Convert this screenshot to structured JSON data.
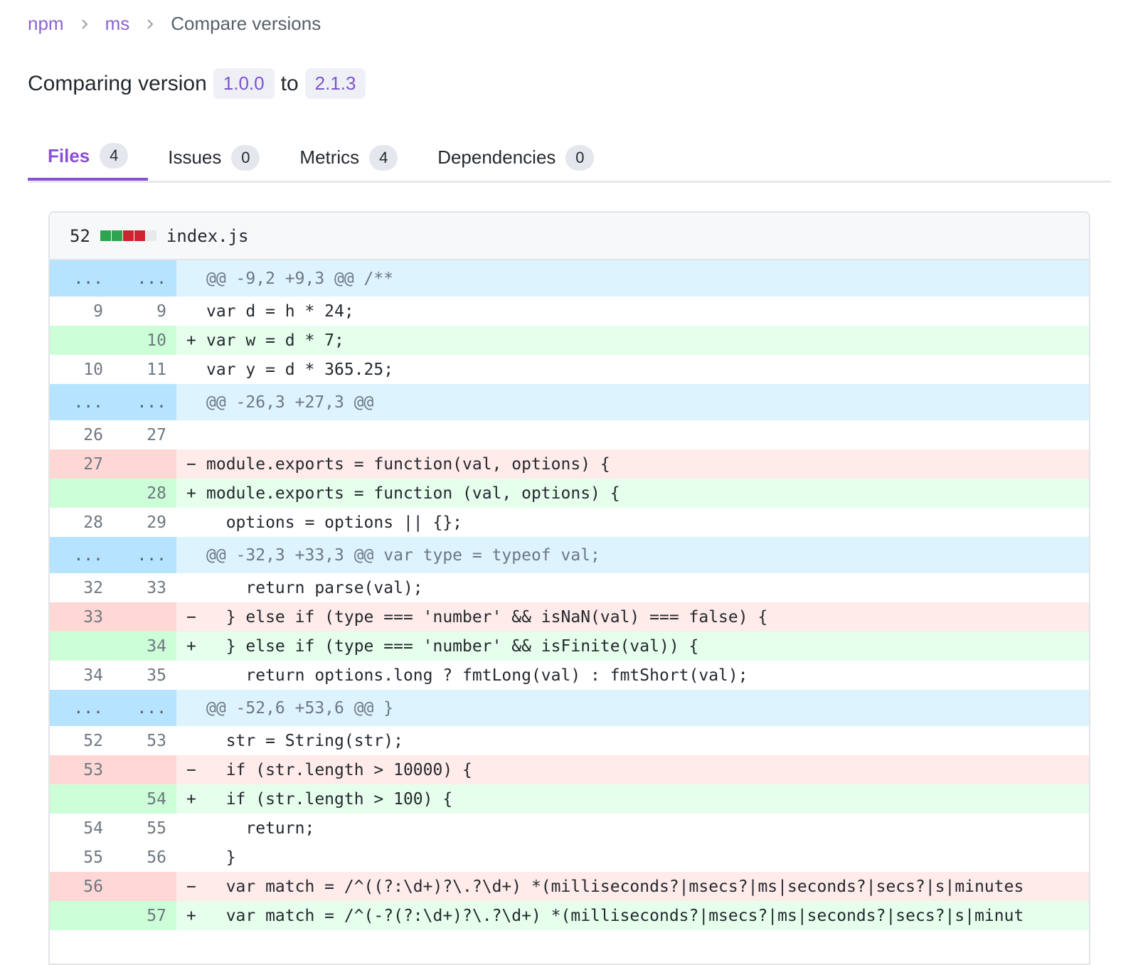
{
  "breadcrumb": {
    "items": [
      "npm",
      "ms"
    ],
    "current": "Compare versions",
    "separator_icon": "chevron-right-icon"
  },
  "compare": {
    "prefix": "Comparing version",
    "from_version": "1.0.0",
    "middle": "to",
    "to_version": "2.1.3"
  },
  "tabs": [
    {
      "label": "Files",
      "count": "4",
      "active": true
    },
    {
      "label": "Issues",
      "count": "0",
      "active": false
    },
    {
      "label": "Metrics",
      "count": "4",
      "active": false
    },
    {
      "label": "Dependencies",
      "count": "0",
      "active": false
    }
  ],
  "colors": {
    "accent": "#8a4fd9",
    "added_bg": "#e6ffec",
    "removed_bg": "#ffebe9",
    "hunk_bg": "#ddf4ff"
  },
  "file": {
    "changes": "52",
    "name": "index.js",
    "stat_blocks": [
      "add",
      "add",
      "del",
      "del",
      "neutral"
    ]
  },
  "diff": [
    {
      "type": "hunk",
      "old": "...",
      "new": "...",
      "text": "@@ -9,2 +9,3 @@ /**"
    },
    {
      "type": "ctx",
      "old": "9",
      "new": "9",
      "text": "var d = h * 24;"
    },
    {
      "type": "add",
      "old": "",
      "new": "10",
      "text": "var w = d * 7;"
    },
    {
      "type": "ctx",
      "old": "10",
      "new": "11",
      "text": "var y = d * 365.25;"
    },
    {
      "type": "hunk",
      "old": "...",
      "new": "...",
      "text": "@@ -26,3 +27,3 @@"
    },
    {
      "type": "ctx",
      "old": "26",
      "new": "27",
      "text": ""
    },
    {
      "type": "del",
      "old": "27",
      "new": "",
      "text": "module.exports = function(val, options) {"
    },
    {
      "type": "add",
      "old": "",
      "new": "28",
      "text": "module.exports = function (val, options) {"
    },
    {
      "type": "ctx",
      "old": "28",
      "new": "29",
      "text": "  options = options || {};"
    },
    {
      "type": "hunk",
      "old": "...",
      "new": "...",
      "text": "@@ -32,3 +33,3 @@ var type = typeof val;"
    },
    {
      "type": "ctx",
      "old": "32",
      "new": "33",
      "text": "    return parse(val);"
    },
    {
      "type": "del",
      "old": "33",
      "new": "",
      "text": "  } else if (type === 'number' && isNaN(val) === false) {"
    },
    {
      "type": "add",
      "old": "",
      "new": "34",
      "text": "  } else if (type === 'number' && isFinite(val)) {"
    },
    {
      "type": "ctx",
      "old": "34",
      "new": "35",
      "text": "    return options.long ? fmtLong(val) : fmtShort(val);"
    },
    {
      "type": "hunk",
      "old": "...",
      "new": "...",
      "text": "@@ -52,6 +53,6 @@ }"
    },
    {
      "type": "ctx",
      "old": "52",
      "new": "53",
      "text": "  str = String(str);"
    },
    {
      "type": "del",
      "old": "53",
      "new": "",
      "text": "  if (str.length > 10000) {"
    },
    {
      "type": "add",
      "old": "",
      "new": "54",
      "text": "  if (str.length > 100) {"
    },
    {
      "type": "ctx",
      "old": "54",
      "new": "55",
      "text": "    return;"
    },
    {
      "type": "ctx",
      "old": "55",
      "new": "56",
      "text": "  }"
    },
    {
      "type": "del",
      "old": "56",
      "new": "",
      "text": "  var match = /^((?:\\d+)?\\.?\\d+) *(milliseconds?|msecs?|ms|seconds?|secs?|s|minutes"
    },
    {
      "type": "add",
      "old": "",
      "new": "57",
      "text": "  var match = /^(-?(?:\\d+)?\\.?\\d+) *(milliseconds?|msecs?|ms|seconds?|secs?|s|minut"
    }
  ]
}
